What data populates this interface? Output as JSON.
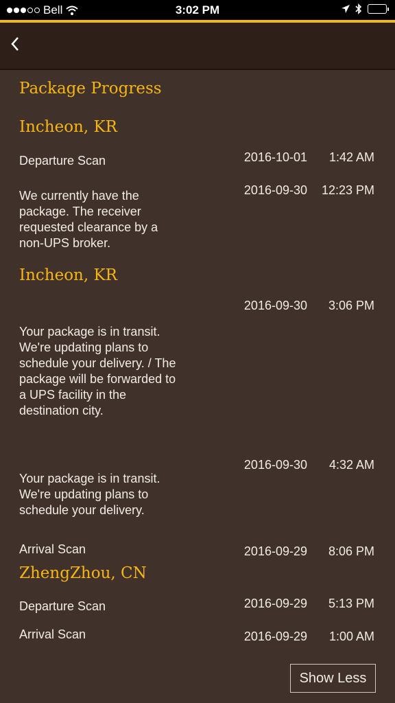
{
  "status": {
    "carrier": "Bell",
    "time": "3:02 PM"
  },
  "page": {
    "title": "Package Progress",
    "show_less_label": "Show Less"
  },
  "cities": [
    "Incheon, KR",
    "Incheon, KR",
    "ZhengZhou, CN"
  ],
  "events": [
    {
      "activity": "Departure Scan",
      "date": "2016-10-01",
      "time": "1:42 AM"
    },
    {
      "activity": "We currently have the package. The receiver requested clearance by a non-UPS broker.",
      "date": "2016-09-30",
      "time": "12:23 PM"
    },
    {
      "activity": "Your package is in transit. We're updating plans to schedule your delivery.  / The package will be forwarded to a UPS facility in the destination city.",
      "date": "2016-09-30",
      "time": "3:06 PM"
    },
    {
      "activity": "Your package is in transit. We're updating plans to schedule your delivery.",
      "date": "2016-09-30",
      "time": "4:32 AM"
    },
    {
      "activity": "Arrival Scan",
      "date": "2016-09-29",
      "time": "8:06 PM"
    },
    {
      "activity": "Departure Scan",
      "date": "2016-09-29",
      "time": "5:13 PM"
    },
    {
      "activity": "Arrival Scan",
      "date": "2016-09-29",
      "time": "1:00 AM"
    }
  ]
}
